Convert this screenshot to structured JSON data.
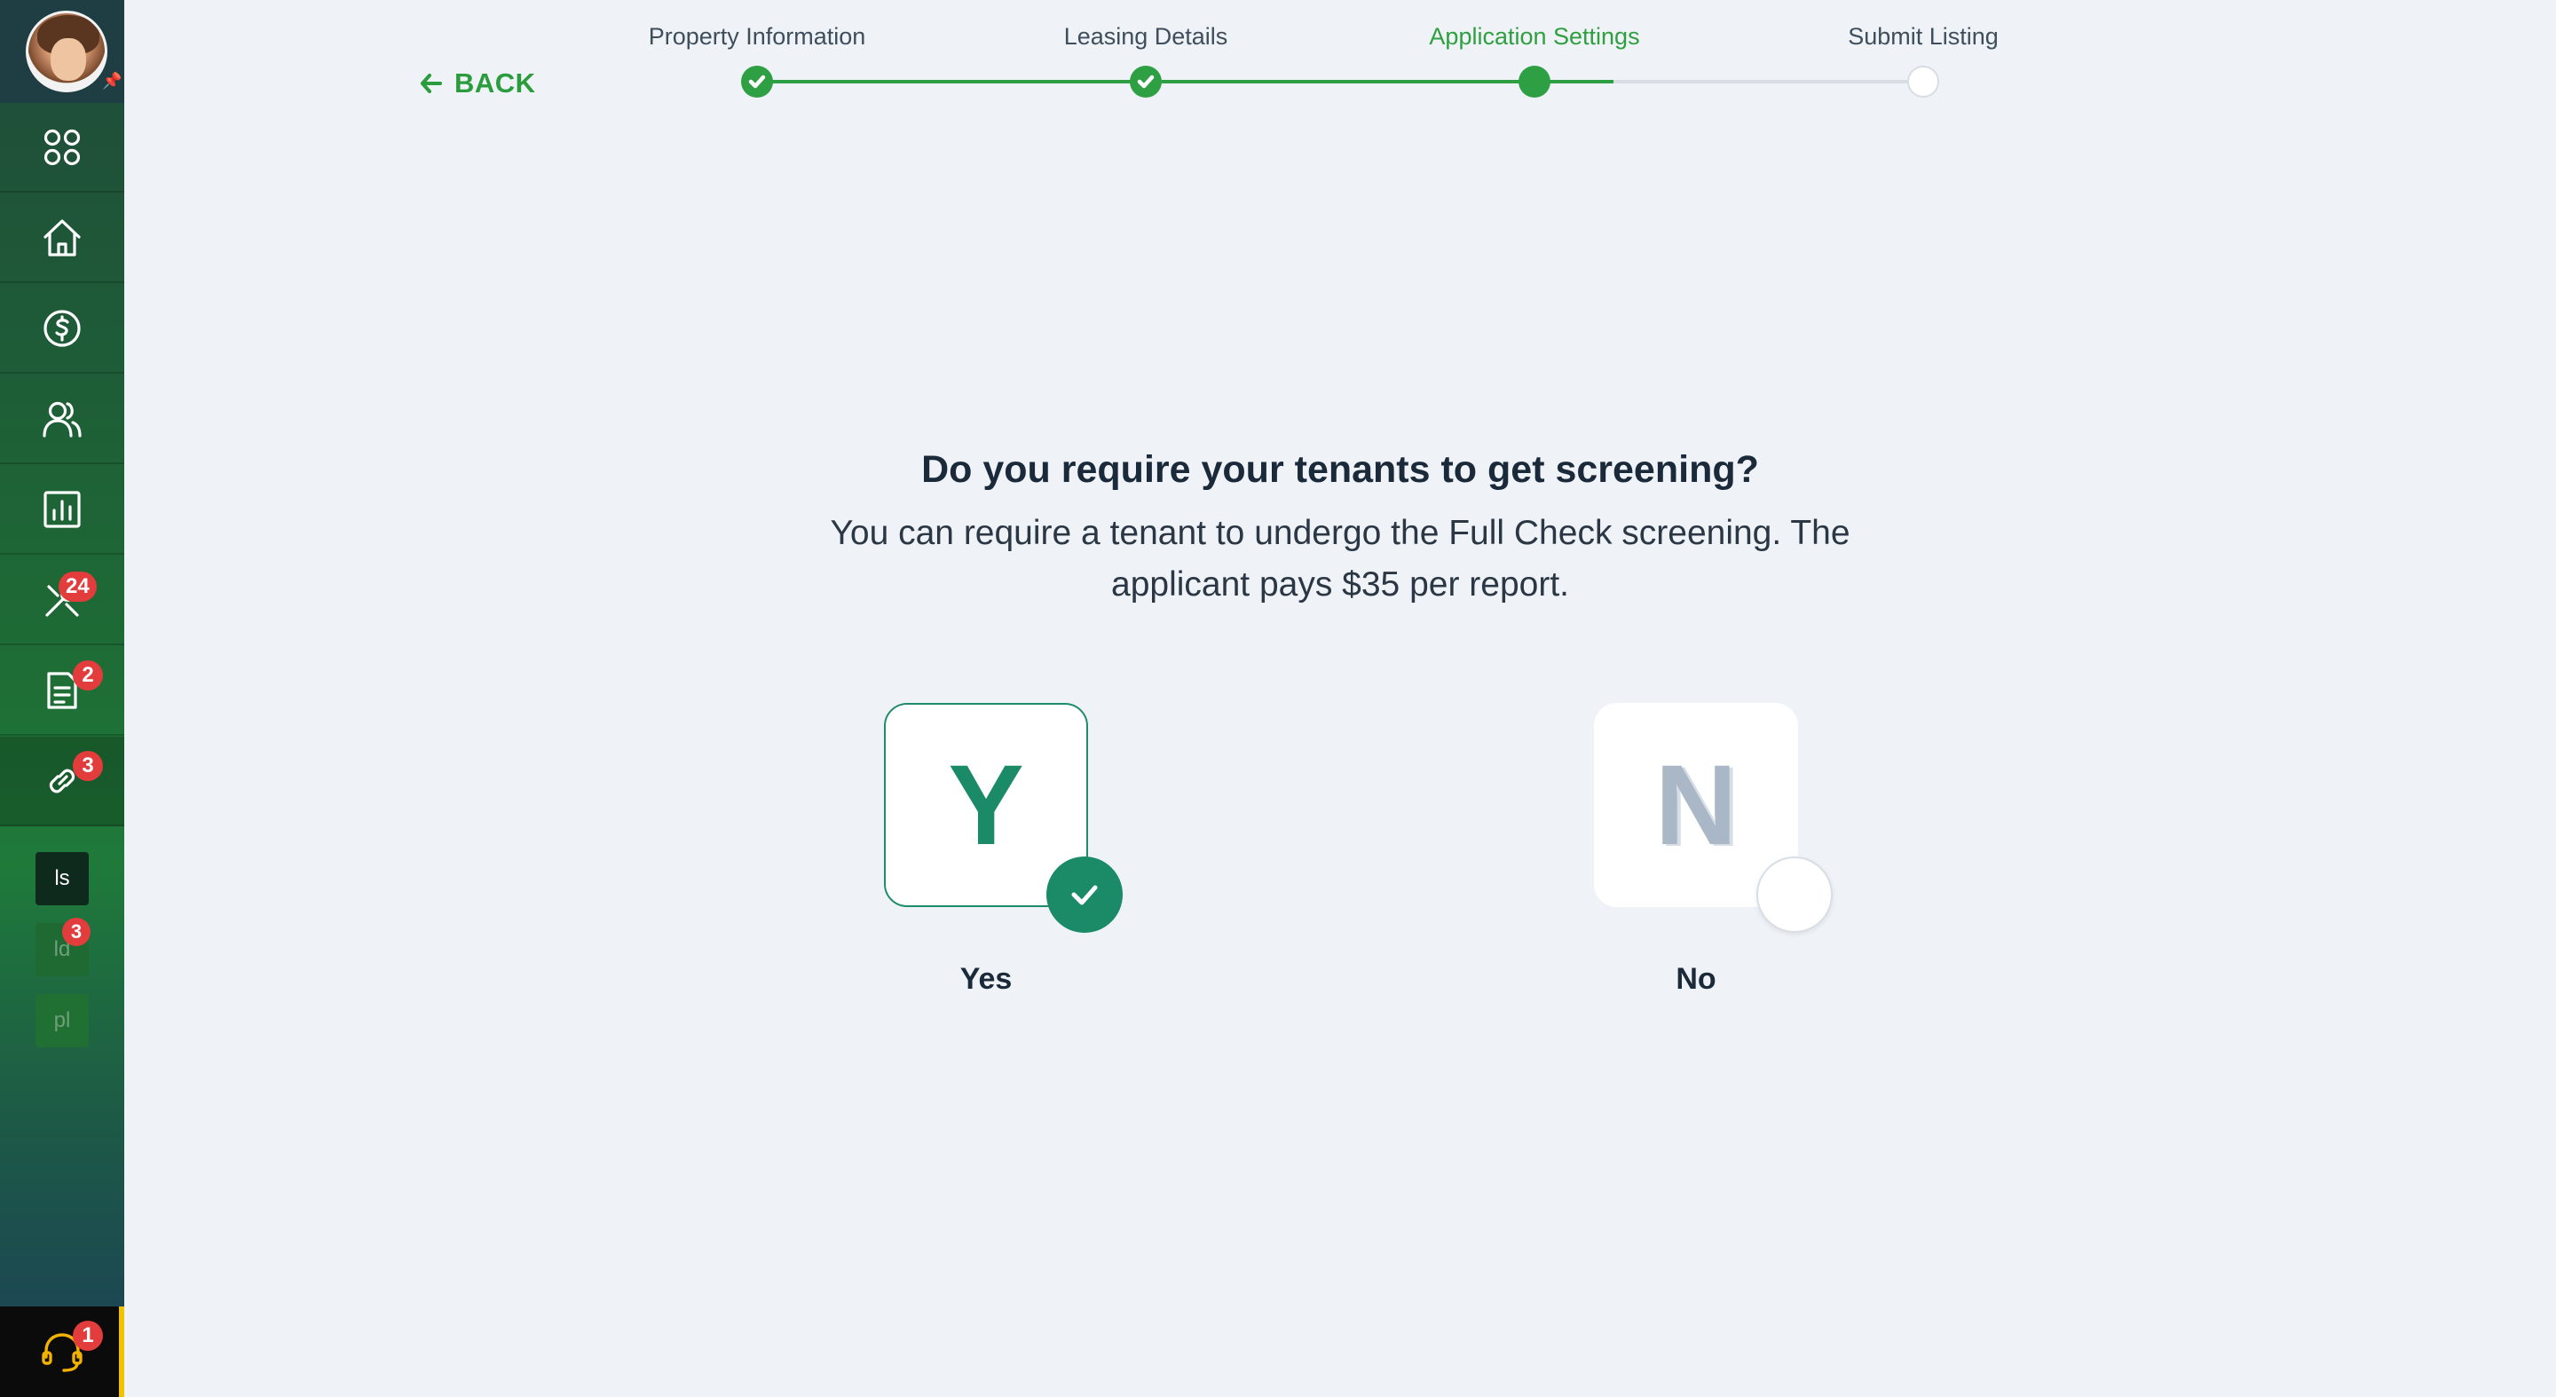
{
  "sidebar": {
    "avatar_alt": "User profile",
    "nav": [
      {
        "name": "apps-icon"
      },
      {
        "name": "home-icon"
      },
      {
        "name": "payments-icon"
      },
      {
        "name": "people-icon"
      },
      {
        "name": "reports-icon"
      },
      {
        "name": "maintenance-icon",
        "badge": "24"
      },
      {
        "name": "documents-icon",
        "badge": "2"
      },
      {
        "name": "listings-icon",
        "badge": "3",
        "active": true
      }
    ],
    "mini_items": [
      {
        "label": "ls",
        "badge": ""
      },
      {
        "label": "ld",
        "badge": "3"
      },
      {
        "label": "pl",
        "badge": ""
      }
    ],
    "support_badge": "1"
  },
  "header": {
    "back_label": "BACK",
    "steps": [
      {
        "label": "Property Information",
        "state": "done"
      },
      {
        "label": "Leasing Details",
        "state": "done"
      },
      {
        "label": "Application Settings",
        "state": "current"
      },
      {
        "label": "Submit Listing",
        "state": "pending"
      }
    ]
  },
  "main": {
    "question": "Do you require your tenants to get screening?",
    "subtext_line1": "You can require a tenant to undergo the Full Check screening. The",
    "subtext_line2": "applicant pays $35 per report.",
    "options": [
      {
        "letter": "Y",
        "label": "Yes",
        "selected": true
      },
      {
        "letter": "N",
        "label": "No",
        "selected": false
      }
    ]
  },
  "colors": {
    "accent_green": "#2ea043",
    "selected_teal": "#1a8a67",
    "badge_red": "#e23c3c",
    "support_yellow": "#f2b300"
  }
}
